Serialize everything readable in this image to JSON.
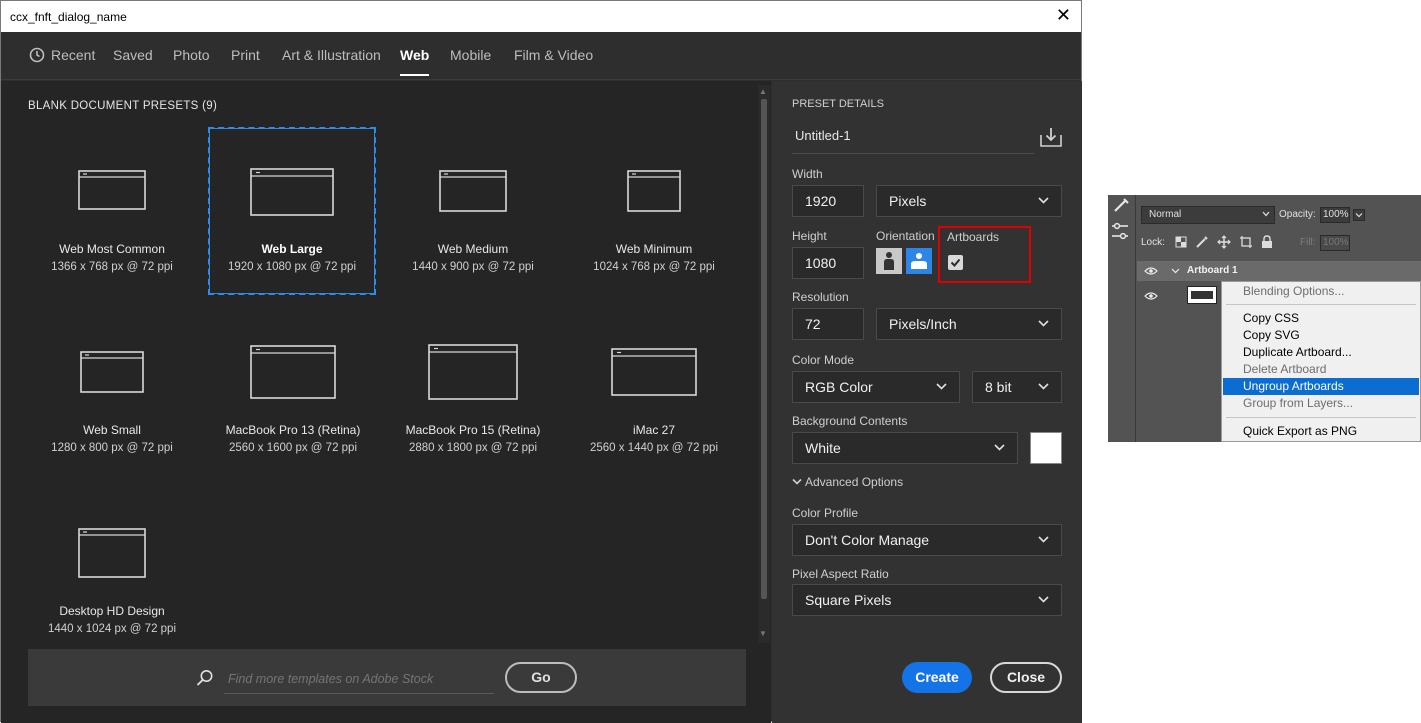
{
  "window": {
    "title": "ccx_fnft_dialog_name",
    "close_symbol": "✕"
  },
  "tabs": [
    {
      "label": "Recent"
    },
    {
      "label": "Saved"
    },
    {
      "label": "Photo"
    },
    {
      "label": "Print"
    },
    {
      "label": "Art & Illustration"
    },
    {
      "label": "Web",
      "active": true
    },
    {
      "label": "Mobile"
    },
    {
      "label": "Film & Video"
    }
  ],
  "presets_panel": {
    "title": "BLANK DOCUMENT PRESETS",
    "count": "(9)",
    "items": [
      {
        "name": "Web Most Common",
        "dims": "1366 x 768 px @ 72 ppi"
      },
      {
        "name": "Web Large",
        "dims": "1920 x 1080 px @ 72 ppi",
        "selected": true
      },
      {
        "name": "Web Medium",
        "dims": "1440 x 900 px @ 72 ppi"
      },
      {
        "name": "Web Minimum",
        "dims": "1024 x 768 px @ 72 ppi"
      },
      {
        "name": "Web Small",
        "dims": "1280 x 800 px @ 72 ppi"
      },
      {
        "name": "MacBook Pro 13 (Retina)",
        "dims": "2560 x 1600 px @ 72 ppi"
      },
      {
        "name": "MacBook Pro 15 (Retina)",
        "dims": "2880 x 1800 px @ 72 ppi"
      },
      {
        "name": "iMac 27",
        "dims": "2560 x 1440 px @ 72 ppi"
      },
      {
        "name": "Desktop HD Design",
        "dims": "1440 x 1024 px @ 72 ppi"
      }
    ]
  },
  "search": {
    "placeholder": "Find more templates on Adobe Stock",
    "go_label": "Go"
  },
  "details": {
    "heading": "PRESET DETAILS",
    "doc_name": "Untitled-1",
    "width_label": "Width",
    "width_value": "1920",
    "width_unit": "Pixels",
    "height_label": "Height",
    "height_value": "1080",
    "orientation_label": "Orientation",
    "artboards_label": "Artboards",
    "artboards_checked": true,
    "resolution_label": "Resolution",
    "resolution_value": "72",
    "resolution_unit": "Pixels/Inch",
    "color_mode_label": "Color Mode",
    "color_mode_value": "RGB Color",
    "bit_depth": "8 bit",
    "bg_label": "Background Contents",
    "bg_value": "White",
    "bg_color": "#ffffff",
    "advanced_label": "Advanced Options",
    "profile_label": "Color Profile",
    "profile_value": "Don't Color Manage",
    "par_label": "Pixel Aspect Ratio",
    "par_value": "Square Pixels",
    "create_label": "Create",
    "close_label": "Close"
  },
  "layers_panel": {
    "blend_mode": "Normal",
    "opacity_label": "Opacity:",
    "opacity_value": "100%",
    "lock_label": "Lock:",
    "fill_label": "Fill:",
    "fill_value": "100%",
    "artboard_name": "Artboard 1"
  },
  "context_menu": {
    "items": [
      {
        "label": "Blending Options...",
        "disabled": true
      },
      {
        "label": "Copy CSS"
      },
      {
        "label": "Copy SVG"
      },
      {
        "label": "Duplicate Artboard..."
      },
      {
        "label": "Delete Artboard",
        "disabled": true
      },
      {
        "label": "Ungroup Artboards",
        "highlighted": true
      },
      {
        "label": "Group from Layers...",
        "disabled": true
      },
      {
        "label": "Quick Export as PNG"
      }
    ]
  },
  "colors": {
    "accent": "#1473e6",
    "selection": "#2d8ceb",
    "highlight_box": "#e00000",
    "menu_highlight": "#0b6dd2"
  }
}
